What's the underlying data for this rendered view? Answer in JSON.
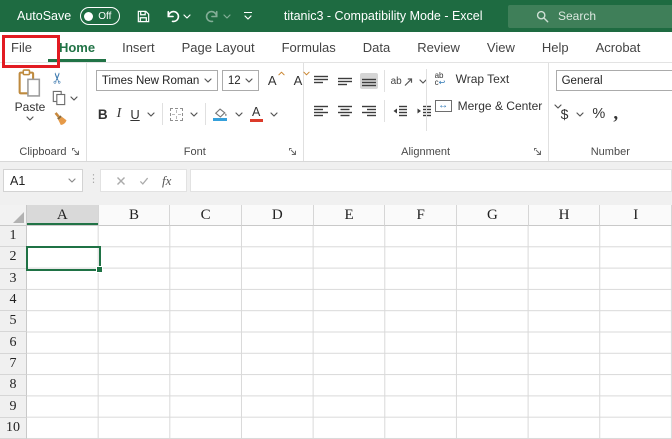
{
  "window": {
    "title": "titanic3  -  Compatibility Mode  -  Excel"
  },
  "titlebar": {
    "autosave_label": "AutoSave",
    "autosave_state": "Off",
    "search_label": "Search"
  },
  "tabs": [
    "File",
    "Home",
    "Insert",
    "Page Layout",
    "Formulas",
    "Data",
    "Review",
    "View",
    "Help",
    "Acrobat"
  ],
  "ribbon": {
    "clipboard": {
      "label": "Clipboard",
      "paste": "Paste"
    },
    "font": {
      "label": "Font",
      "name": "Times New Roman",
      "size": "12",
      "bold": "B",
      "italic": "I",
      "underline": "U",
      "grow": "A",
      "shrink": "A"
    },
    "alignment": {
      "label": "Alignment",
      "wrap": "Wrap Text",
      "merge": "Merge & Center",
      "orientation_ab": "ab",
      "wrap_ab": "ab",
      "wrap_c": "c",
      "wrap_arrow": "↩",
      "merge_arrow": "↔"
    },
    "number": {
      "label": "Number",
      "format": "General",
      "currency": "$",
      "percent": "%",
      "comma": ","
    }
  },
  "formula_bar": {
    "cell_ref": "A1",
    "fx_label": "fx",
    "value": ""
  },
  "grid": {
    "selected_cell": "A1",
    "columns": [
      "A",
      "B",
      "C",
      "D",
      "E",
      "F",
      "G",
      "H",
      "I"
    ],
    "rows": [
      "1",
      "2",
      "3",
      "4",
      "5",
      "6",
      "7",
      "8",
      "9",
      "10"
    ]
  },
  "annotation": {
    "highlight_target": "File tab",
    "color": "#E21B22"
  },
  "colors": {
    "titlebar_green": "#1E6B41",
    "accent_green": "#217346",
    "search_bg": "#3F7F59",
    "selection_border": "#1F7245",
    "selected_header_bg": "#D9D9D9"
  }
}
